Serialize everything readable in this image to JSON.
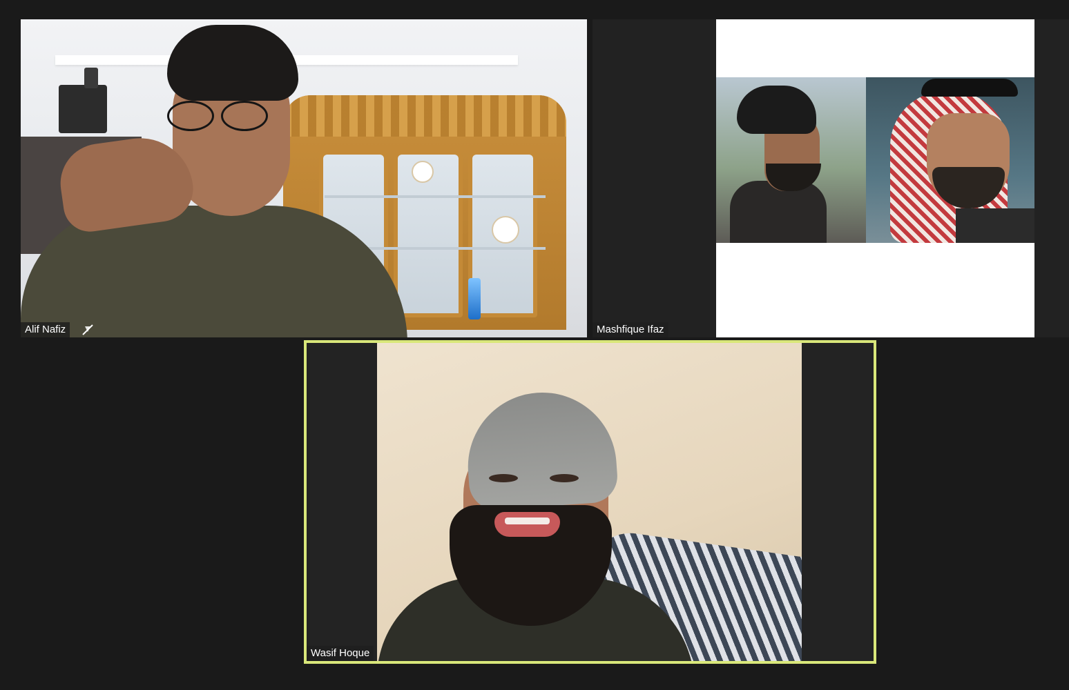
{
  "meeting": {
    "participants": [
      {
        "name": "Alif Nafiz",
        "video": "camera-on",
        "active_speaker": false
      },
      {
        "name": "Mashfique Ifaz",
        "video": "shared-image",
        "active_speaker": false
      },
      {
        "name": "Wasif Hoque",
        "video": "camera-on",
        "active_speaker": true
      }
    ]
  },
  "colors": {
    "background": "#1a1a1a",
    "active_speaker_border": "#d9e77a",
    "label_bg": "#1e1e1e",
    "label_text": "#ffffff"
  },
  "icons": {
    "alif_tile_indicator": "muted-icon"
  }
}
